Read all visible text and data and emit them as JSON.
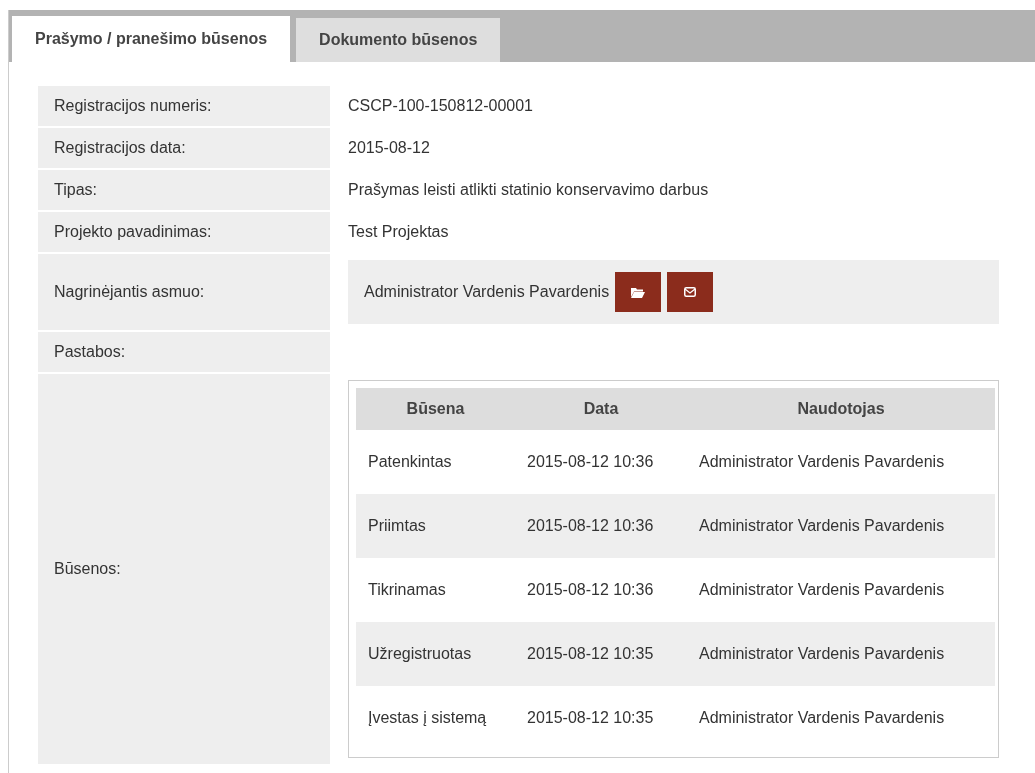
{
  "tabs": [
    {
      "label": "Prašymo / pranešimo būsenos",
      "selected": true
    },
    {
      "label": "Dokumento būsenos",
      "selected": false
    }
  ],
  "details": [
    {
      "label": "Registracijos numeris:",
      "value": "CSCP-100-150812-00001"
    },
    {
      "label": "Registracijos data:",
      "value": "2015-08-12"
    },
    {
      "label": "Tipas:",
      "value": "Prašymas leisti atlikti statinio konservavimo darbus"
    },
    {
      "label": "Projekto pavadinimas:",
      "value": "Test Projektas"
    }
  ],
  "handler": {
    "label": "Nagrinėjantis asmuo:",
    "value": "Administrator Vardenis Pavardenis"
  },
  "notes": {
    "label": "Pastabos:"
  },
  "statuses": {
    "label": "Būsenos:",
    "columns": [
      "Būsena",
      "Data",
      "Naudotojas"
    ],
    "rows": [
      [
        "Patenkintas",
        "2015-08-12 10:36",
        "Administrator Vardenis Pavardenis"
      ],
      [
        "Priimtas",
        "2015-08-12 10:36",
        "Administrator Vardenis Pavardenis"
      ],
      [
        "Tikrinamas",
        "2015-08-12 10:36",
        "Administrator Vardenis Pavardenis"
      ],
      [
        "Užregistruotas",
        "2015-08-12 10:35",
        "Administrator Vardenis Pavardenis"
      ],
      [
        "Įvestas į sistemą",
        "2015-08-12 10:35",
        "Administrator Vardenis Pavardenis"
      ]
    ]
  }
}
